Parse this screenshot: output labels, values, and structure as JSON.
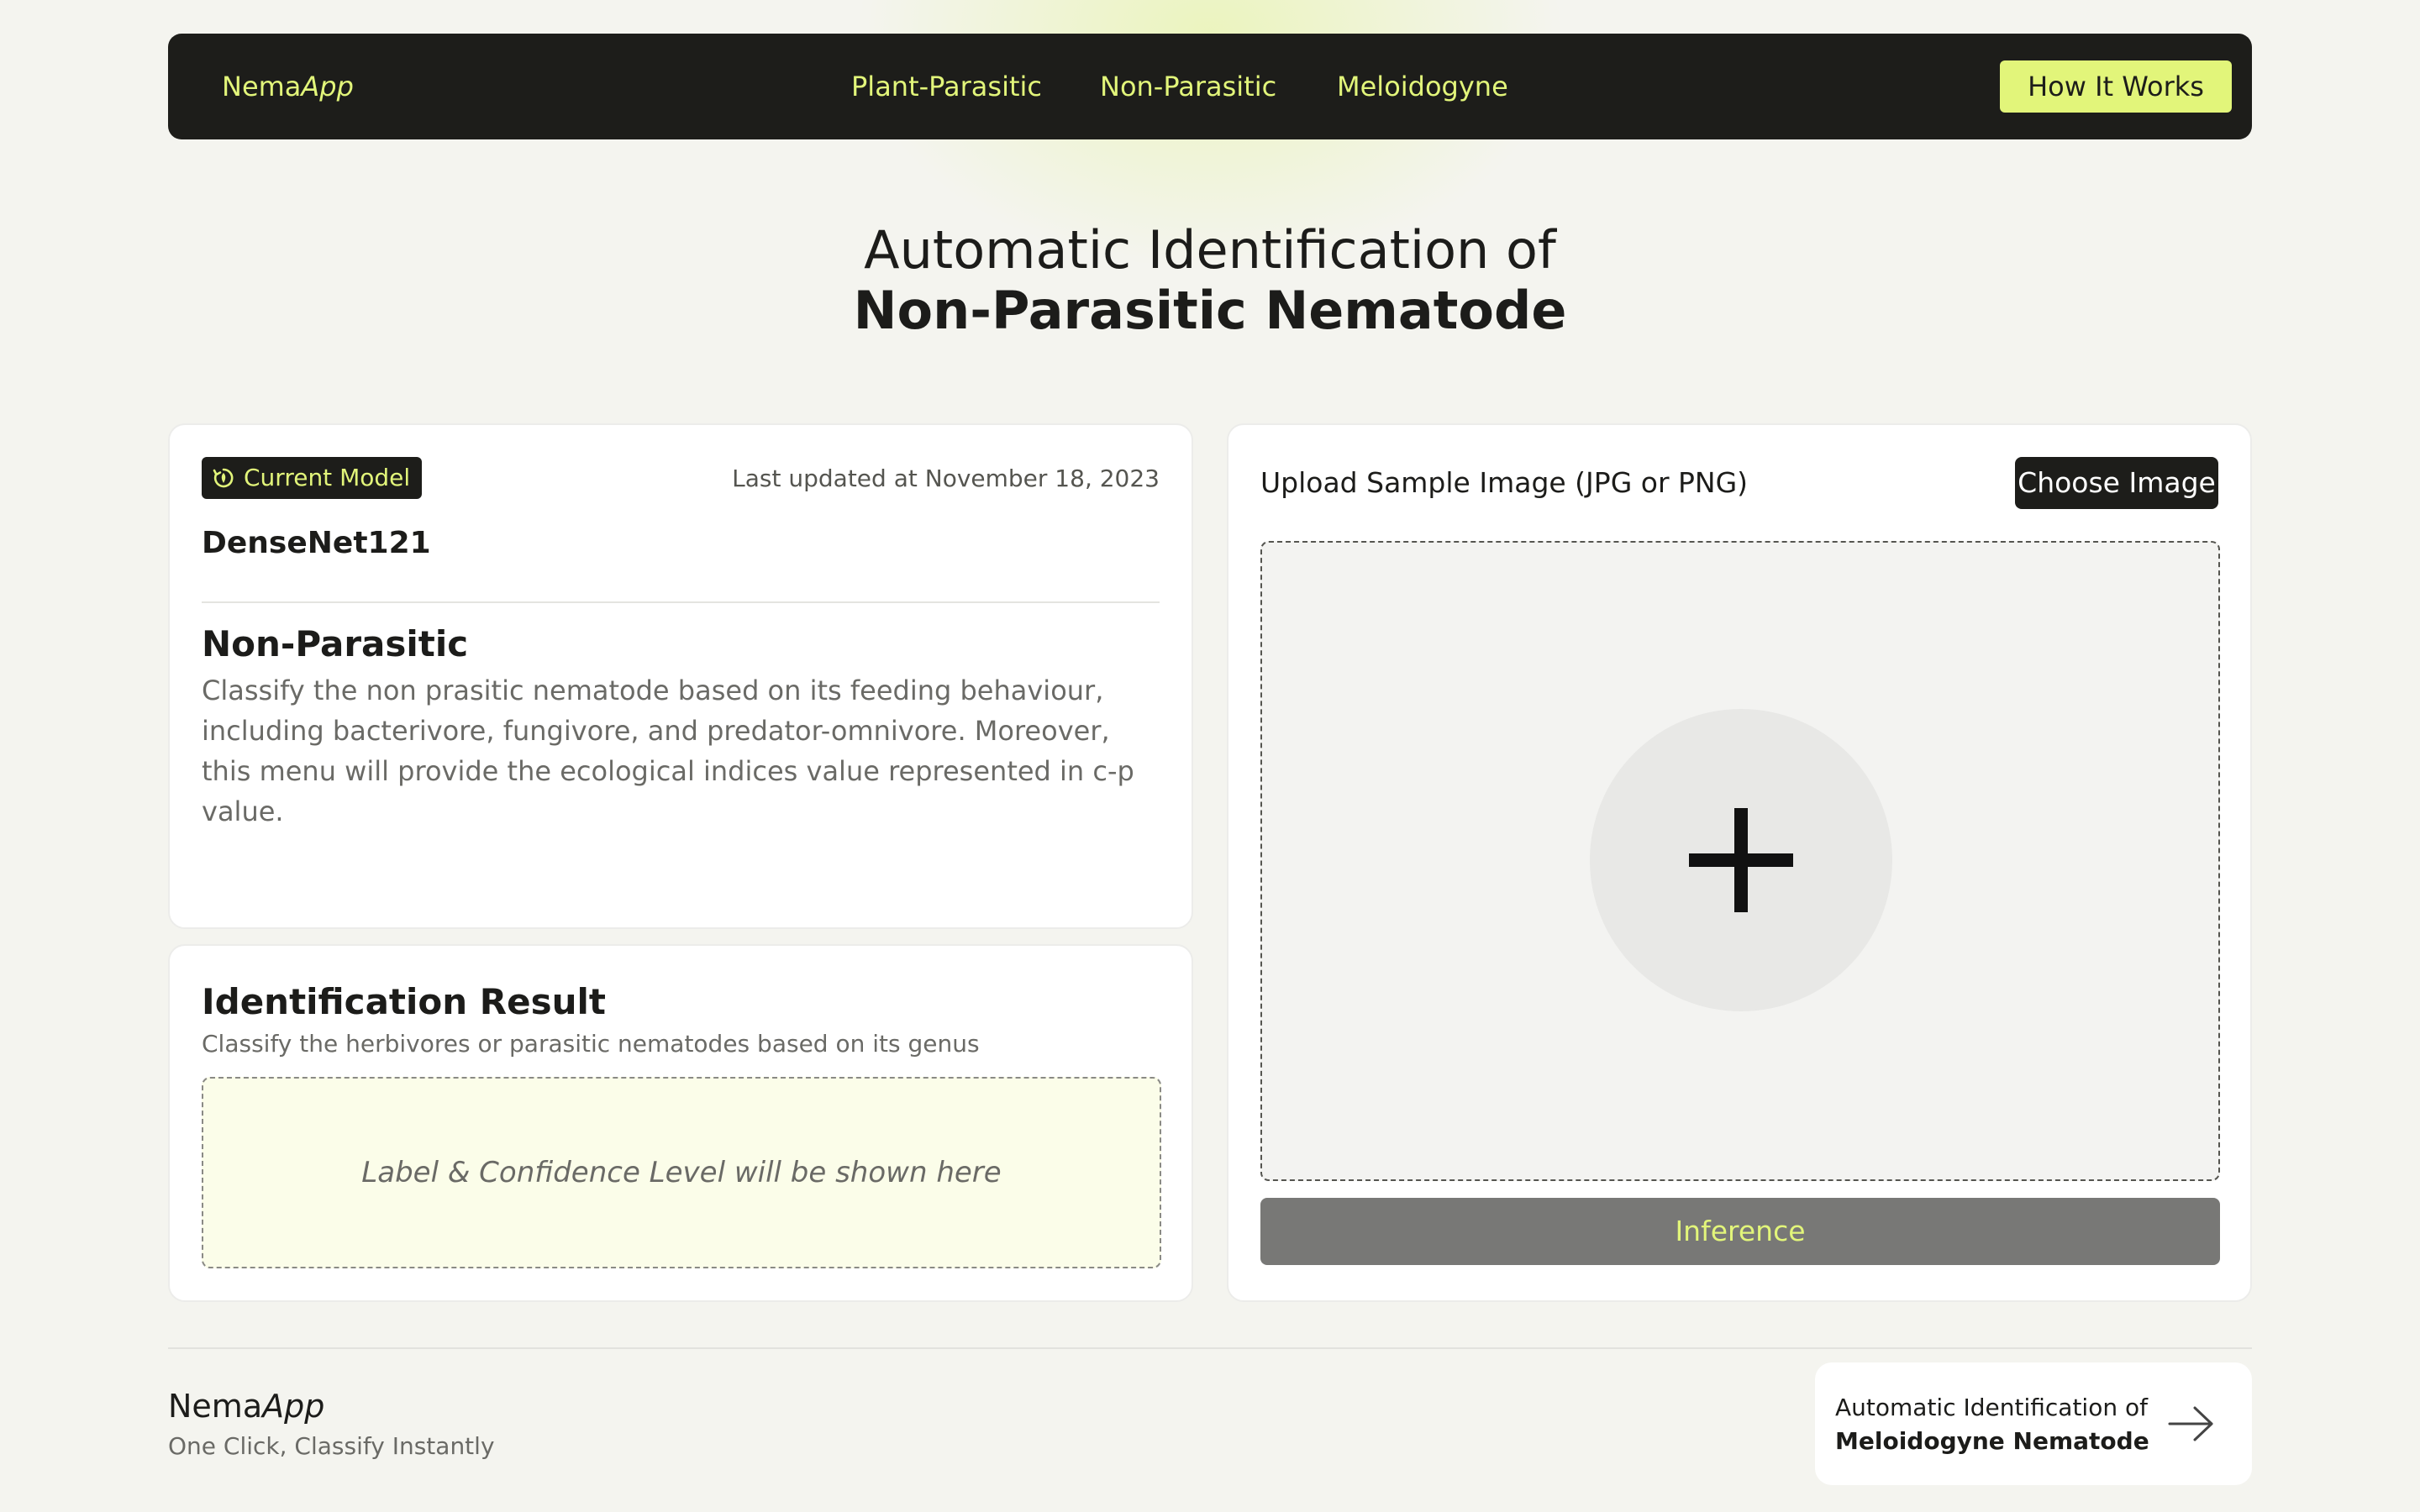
{
  "nav": {
    "brand_main": "Nema",
    "brand_accent": "App",
    "links": [
      "Plant-Parasitic",
      "Non-Parasitic",
      "Meloidogyne"
    ],
    "cta": "How It Works"
  },
  "hero": {
    "line1": "Automatic Identification of",
    "line2": "Non-Parasitic Nematode"
  },
  "model_card": {
    "badge": "Current Model",
    "badge_icon": "model-cycle-icon",
    "updated": "Last updated at November 18, 2023",
    "model_name": "DenseNet121",
    "section_title": "Non-Parasitic",
    "section_desc": "Classify the non prasitic nematode based on its feeding behaviour, including bacterivore, fungivore, and predator-omnivore. Moreover, this menu will provide the ecological indices value represented in c-p value."
  },
  "result_card": {
    "title": "Identification Result",
    "subtitle": "Classify the herbivores or parasitic nematodes based on its genus",
    "placeholder": "Label & Confidence Level will be shown here"
  },
  "upload_card": {
    "label": "Upload Sample Image (JPG or PNG)",
    "choose_button": "Choose Image",
    "dropzone_icon": "plus-icon",
    "inference_button": "Inference"
  },
  "footer": {
    "brand_main": "Nema",
    "brand_accent": "App",
    "tagline": "One Click, Classify Instantly",
    "next_line1": "Automatic Identification of",
    "next_line2": "Meloidogyne Nematode",
    "next_icon": "arrow-right-icon"
  },
  "colors": {
    "accent": "#e2f57a",
    "dark": "#1d1d1a",
    "background": "#f4f4ef",
    "result_box": "#fbfde9",
    "inference_button": "#787876"
  }
}
